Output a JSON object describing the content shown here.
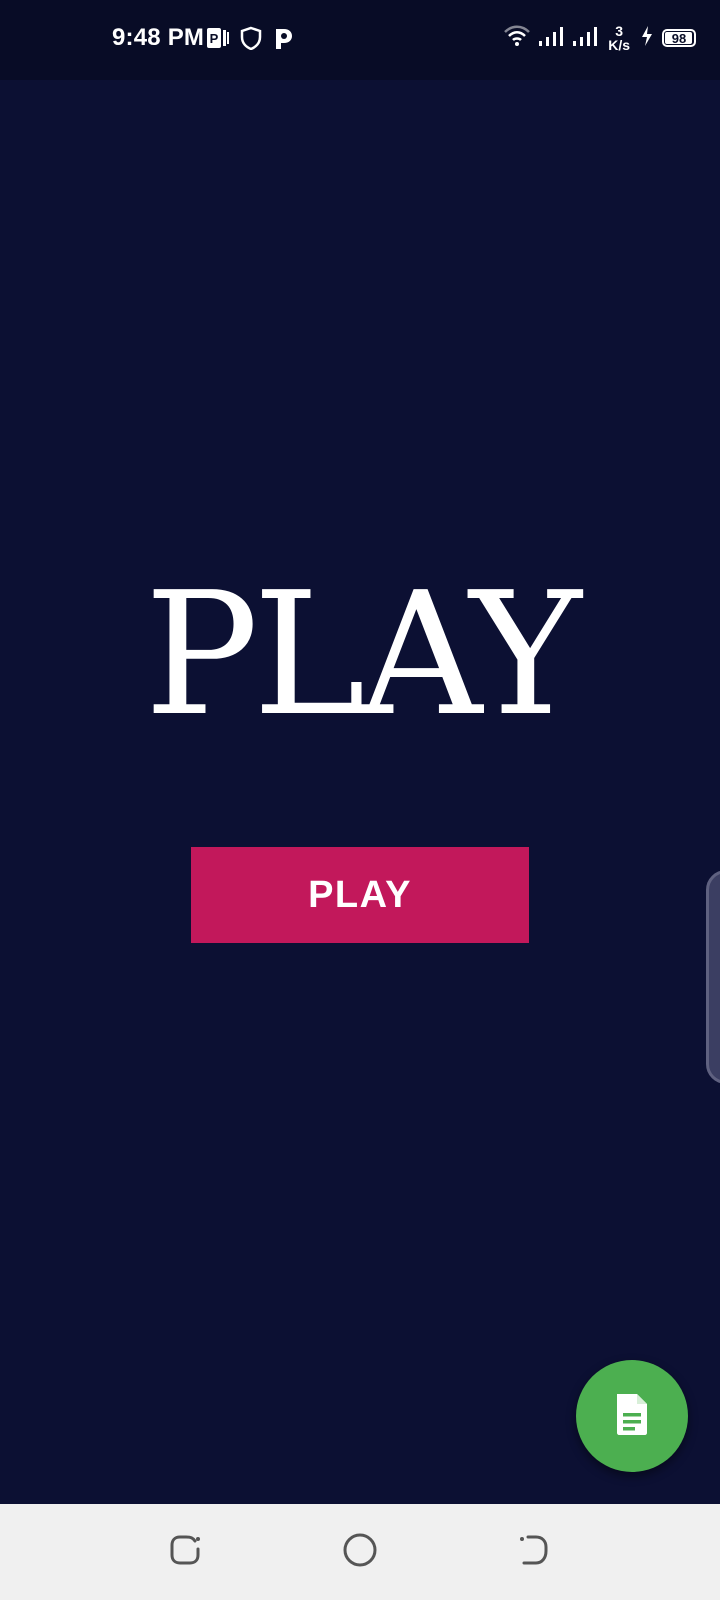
{
  "status_bar": {
    "time": "9:48 PM",
    "speed_value": "3",
    "speed_unit": "K/s",
    "battery_level": "98",
    "battery_fraction": 0.98,
    "left_icons": [
      "parking-app-icon",
      "shield-icon",
      "p-app-icon"
    ],
    "right_icons": [
      "wifi-icon",
      "signal-icon",
      "signal-icon",
      "charging-icon",
      "battery-icon"
    ]
  },
  "main": {
    "logo_text": "PLAY",
    "play_button_label": "PLAY"
  },
  "fab": {
    "icon": "document-icon"
  },
  "nav_bar": {
    "items": [
      "recent-apps-icon",
      "home-icon",
      "back-icon"
    ]
  },
  "colors": {
    "background": "#0c1033",
    "status_bar": "#080c26",
    "button": "#c2185b",
    "fab": "#4caf50",
    "nav_bar": "#f0f0f0"
  }
}
